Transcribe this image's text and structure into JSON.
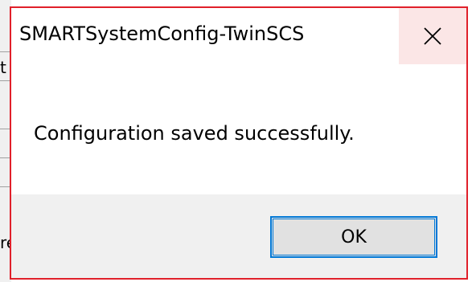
{
  "background_window": {
    "fragments": [
      "t",
      "re"
    ]
  },
  "dialog": {
    "title": "SMARTSystemConfig-TwinSCS",
    "message": "Configuration saved successfully.",
    "ok_label": "OK",
    "close_icon": "close-icon"
  },
  "colors": {
    "dialog_border": "#e0202a",
    "close_hover_bg": "#fbe6e6",
    "footer_bg": "#f0f0f0",
    "ok_border": "#0078d7",
    "ok_bg": "#e1e1e1"
  }
}
